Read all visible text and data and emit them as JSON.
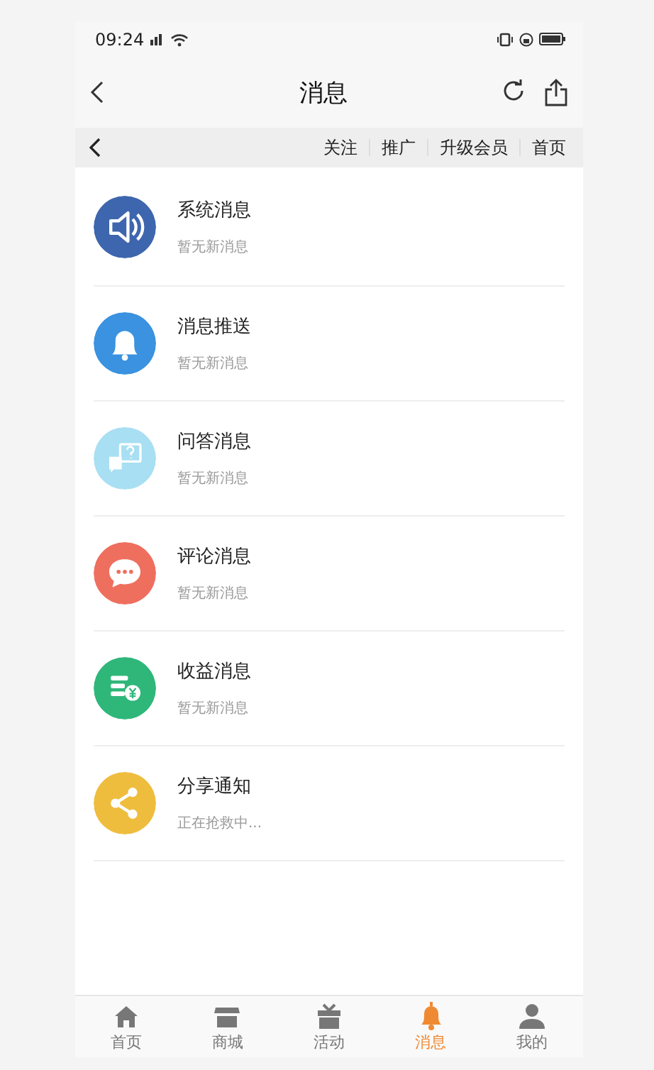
{
  "status_bar": {
    "time": "09:24"
  },
  "header": {
    "title": "消息"
  },
  "subnav": {
    "items": [
      "关注",
      "推广",
      "升级会员",
      "首页"
    ]
  },
  "messages": [
    {
      "kind": "speaker",
      "title": "系统消息",
      "subtitle": "暂无新消息",
      "color": "#3e66ae"
    },
    {
      "kind": "bell",
      "title": "消息推送",
      "subtitle": "暂无新消息",
      "color": "#3a92e0"
    },
    {
      "kind": "question",
      "title": "问答消息",
      "subtitle": "暂无新消息",
      "color": "#a8dff2"
    },
    {
      "kind": "comment",
      "title": "评论消息",
      "subtitle": "暂无新消息",
      "color": "#ef6f5f"
    },
    {
      "kind": "coins",
      "title": "收益消息",
      "subtitle": "暂无新消息",
      "color": "#2fb77a"
    },
    {
      "kind": "share",
      "title": "分享通知",
      "subtitle": "正在抢救中...",
      "color": "#efbd3e"
    }
  ],
  "tabbar": [
    {
      "kind": "home",
      "label": "首页",
      "selected": false
    },
    {
      "kind": "shop",
      "label": "商城",
      "selected": false
    },
    {
      "kind": "gift",
      "label": "活动",
      "selected": false
    },
    {
      "kind": "bell",
      "label": "消息",
      "selected": true
    },
    {
      "kind": "person",
      "label": "我的",
      "selected": false
    }
  ]
}
